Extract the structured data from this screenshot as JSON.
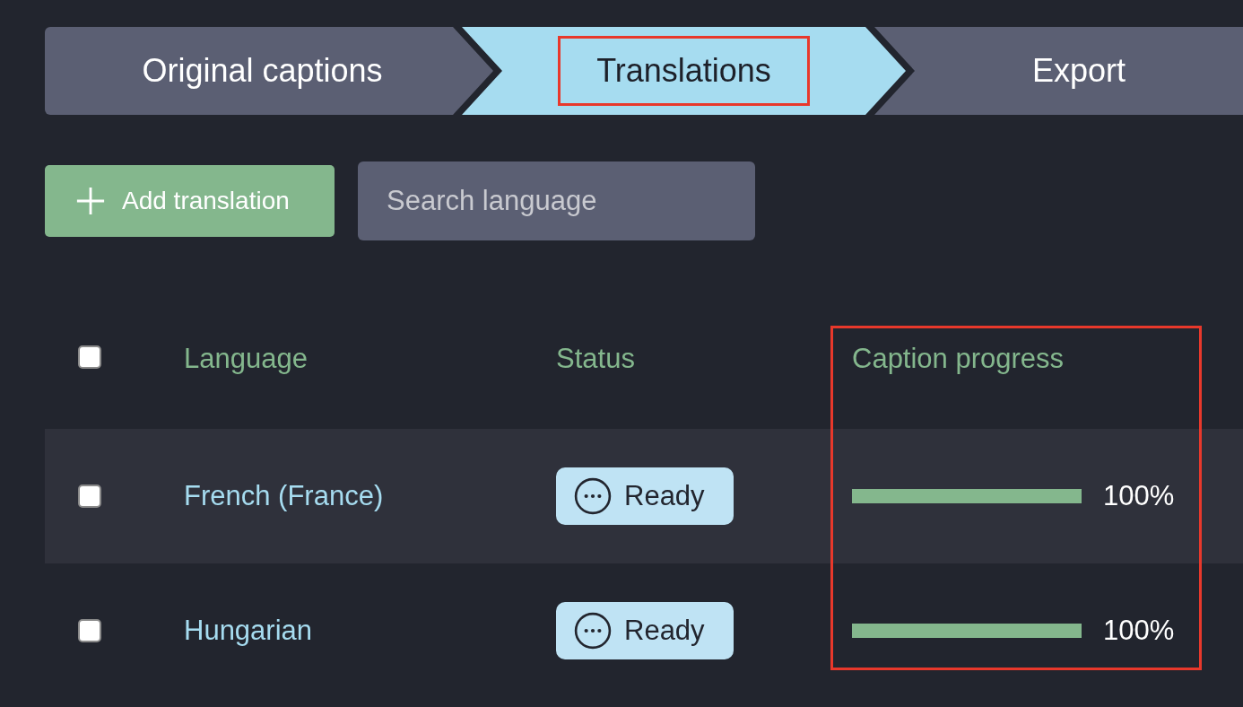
{
  "steps": [
    {
      "label": "Original captions",
      "selected": false,
      "highlighted": false
    },
    {
      "label": "Translations",
      "selected": true,
      "highlighted": true
    },
    {
      "label": "Export",
      "selected": false,
      "highlighted": false
    }
  ],
  "toolbar": {
    "add_button": "Add translation",
    "search": {
      "placeholder": "Search language"
    }
  },
  "table": {
    "select_all": {
      "checked": false
    },
    "columns": [
      {
        "label": "Language",
        "highlighted": false
      },
      {
        "label": "Status",
        "highlighted": false
      },
      {
        "label": "Caption progress",
        "highlighted": true
      }
    ],
    "rows": [
      {
        "checked": false,
        "hovered": true,
        "language": "French (France)",
        "status": "Ready",
        "progress": "100%"
      },
      {
        "checked": false,
        "hovered": false,
        "language": "Hungarian",
        "status": "Ready",
        "progress": "100%"
      }
    ]
  }
}
